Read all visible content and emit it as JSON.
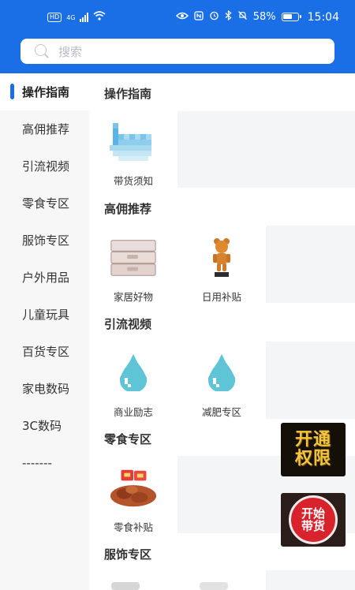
{
  "status_bar": {
    "left_badge": "HD",
    "network": "4G",
    "battery_percent": "58%",
    "time": "15:04",
    "icons": [
      "hd-badge",
      "signal-icon",
      "wifi-icon",
      "eye-icon",
      "nfc-icon",
      "alarm-icon",
      "bluetooth-icon",
      "mute-icon",
      "battery-icon"
    ]
  },
  "search": {
    "placeholder": "搜索"
  },
  "sidebar": {
    "items": [
      {
        "label": "操作指南",
        "active": true
      },
      {
        "label": "高佣推荐"
      },
      {
        "label": "引流视频"
      },
      {
        "label": "零食专区"
      },
      {
        "label": "服饰专区"
      },
      {
        "label": "户外用品"
      },
      {
        "label": "儿童玩具"
      },
      {
        "label": "百货专区"
      },
      {
        "label": "家电数码"
      },
      {
        "label": "3C数码"
      },
      {
        "label": "-------"
      }
    ]
  },
  "sections": [
    {
      "title": "操作指南",
      "items": [
        {
          "label": "带货须知",
          "icon": "pixel-hand-icon"
        }
      ]
    },
    {
      "title": "高佣推荐",
      "items": [
        {
          "label": "家居好物",
          "icon": "storage-box-image"
        },
        {
          "label": "日用补贴",
          "icon": "bear-figure-image"
        }
      ]
    },
    {
      "title": "引流视频",
      "items": [
        {
          "label": "商业励志",
          "icon": "water-drop-icon"
        },
        {
          "label": "减肥专区",
          "icon": "water-drop-icon"
        }
      ]
    },
    {
      "title": "零食专区",
      "items": [
        {
          "label": "零食补贴",
          "icon": "snack-pack-image"
        }
      ]
    },
    {
      "title": "服饰专区",
      "items": []
    }
  ],
  "promos": [
    {
      "text_line1": "开通",
      "text_line2": "权限",
      "colors": {
        "bg": "#141008",
        "text": "#f2c441"
      }
    },
    {
      "text_line1": "开始",
      "text_line2": "带货",
      "colors": {
        "bg": "#2a1d1a",
        "circle": "#d9232c"
      }
    }
  ],
  "colors": {
    "brand": "#1a6fe6",
    "sidebar_bg": "#f7f7f8"
  }
}
